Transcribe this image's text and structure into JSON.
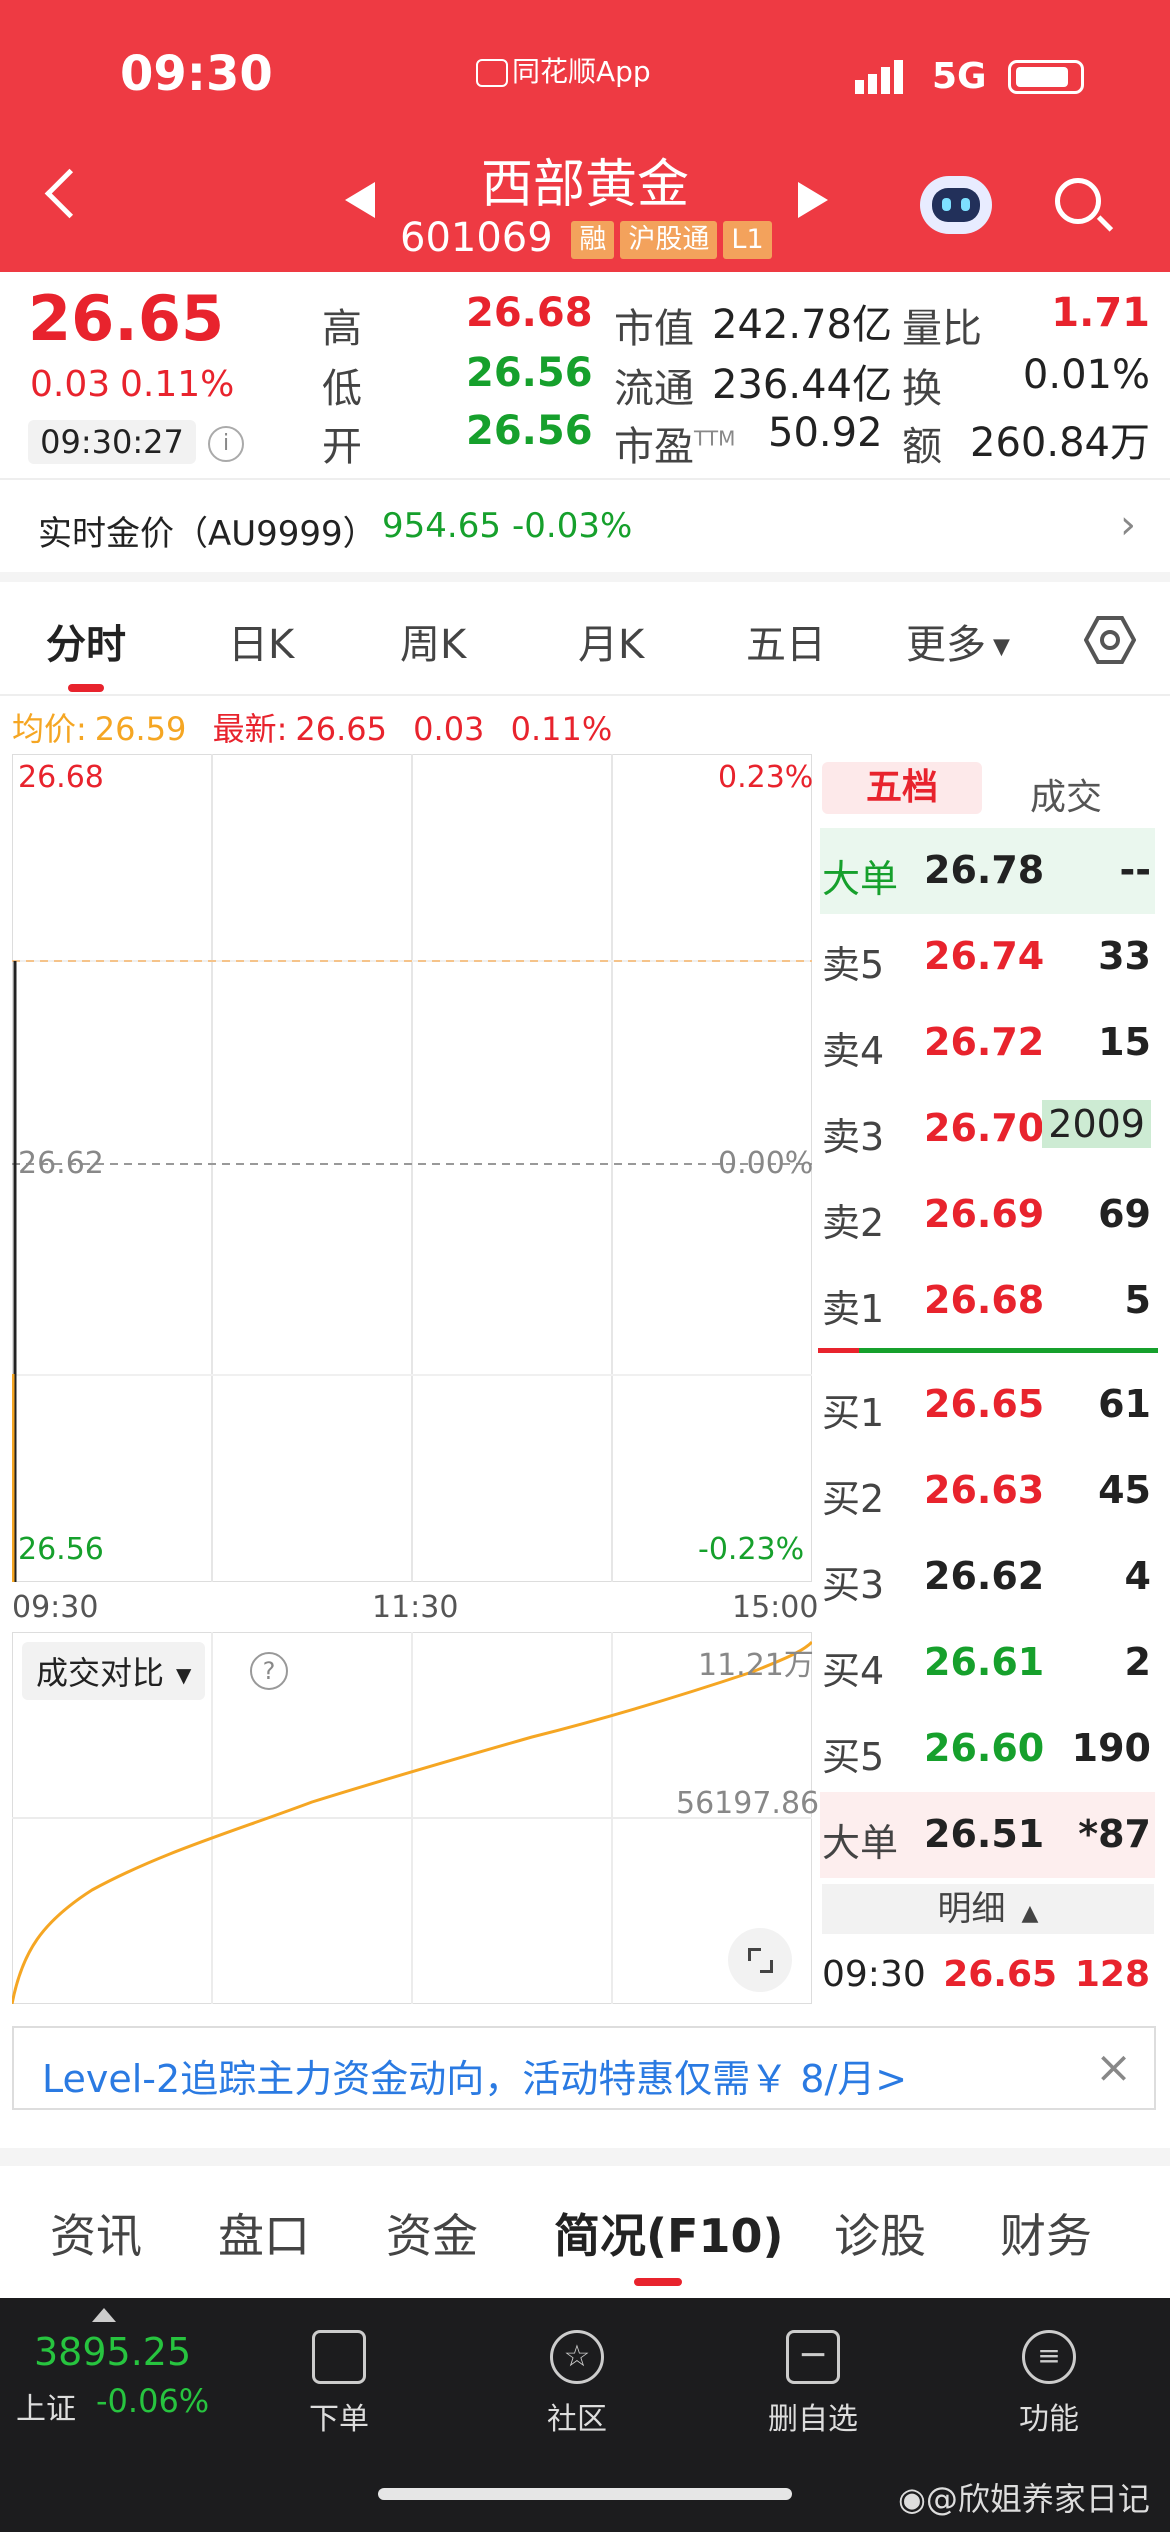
{
  "status_bar": {
    "time": "09:30",
    "app_name": "同花顺App",
    "network": "5G"
  },
  "stock": {
    "name": "西部黄金",
    "code": "601069",
    "tags": [
      "融",
      "沪股通",
      "L1"
    ]
  },
  "quote": {
    "price": "26.65",
    "change": "0.03",
    "change_pct": "0.11%",
    "time": "09:30:27",
    "high_label": "高",
    "high": "26.68",
    "low_label": "低",
    "low": "26.56",
    "open_label": "开",
    "open": "26.56",
    "mktcap_label": "市值",
    "mktcap": "242.78亿",
    "float_label": "流通",
    "float": "236.44亿",
    "pe_label": "市盈",
    "pe_sup": "TTM",
    "pe": "50.92",
    "vol_ratio_label": "量比",
    "vol_ratio": "1.71",
    "turnover_label": "换",
    "turnover": "0.01%",
    "amount_label": "额",
    "amount": "260.84万"
  },
  "gold": {
    "label": "实时金价（AU9999）",
    "price": "954.65",
    "change": "-0.03%"
  },
  "tabs": [
    "分时",
    "日K",
    "周K",
    "月K",
    "五日",
    "更多"
  ],
  "info_line": {
    "avg_label": "均价:",
    "avg": "26.59",
    "latest_label": "最新:",
    "latest": "26.65",
    "chg": "0.03",
    "pct": "0.11%"
  },
  "chart_labels": {
    "top_price": "26.68",
    "top_pct": "0.23%",
    "mid_price": "26.62",
    "mid_pct": "0.00%",
    "bot_price": "26.56",
    "bot_pct": "-0.23%",
    "t_start": "09:30",
    "t_mid": "11:30",
    "t_end": "15:00"
  },
  "volume_panel": {
    "dropdown_label": "成交对比",
    "help": "?",
    "top_value": "11.21万",
    "mid_value": "56197.86"
  },
  "order_book": {
    "tab_active": "五档",
    "tab_other": "成交",
    "rows": [
      {
        "label": "大单",
        "price": "26.78",
        "vol": "--"
      },
      {
        "label": "卖5",
        "price": "26.74",
        "vol": "33"
      },
      {
        "label": "卖4",
        "price": "26.72",
        "vol": "15"
      },
      {
        "label": "卖3",
        "price": "26.70",
        "vol": "2009"
      },
      {
        "label": "卖2",
        "price": "26.69",
        "vol": "69"
      },
      {
        "label": "卖1",
        "price": "26.68",
        "vol": "5"
      },
      {
        "label": "买1",
        "price": "26.65",
        "vol": "61"
      },
      {
        "label": "买2",
        "price": "26.63",
        "vol": "45"
      },
      {
        "label": "买3",
        "price": "26.62",
        "vol": "4"
      },
      {
        "label": "买4",
        "price": "26.61",
        "vol": "2"
      },
      {
        "label": "买5",
        "price": "26.60",
        "vol": "190"
      },
      {
        "label": "大单",
        "price": "26.51",
        "vol": "*87"
      }
    ],
    "detail_label": "明细",
    "detail_row": {
      "time": "09:30",
      "price": "26.65",
      "vol": "128"
    }
  },
  "banner": {
    "text": "Level-2追踪主力资金动向，活动特惠仅需￥ 8/月>",
    "close": "×"
  },
  "bottom_tabs": [
    "资讯",
    "盘口",
    "资金",
    "简况(F10)",
    "诊股",
    "财务"
  ],
  "footer": {
    "index_value": "3895.25",
    "index_name": "上证",
    "index_change": "-0.06%",
    "nav": [
      "下单",
      "社区",
      "删自选",
      "功能"
    ]
  },
  "watermark": "@欣姐养家日记",
  "colors": {
    "header_red": "#ee3a43",
    "up_red": "#e8232d",
    "down_green": "#16a02c",
    "avg_orange": "#f5a623"
  }
}
